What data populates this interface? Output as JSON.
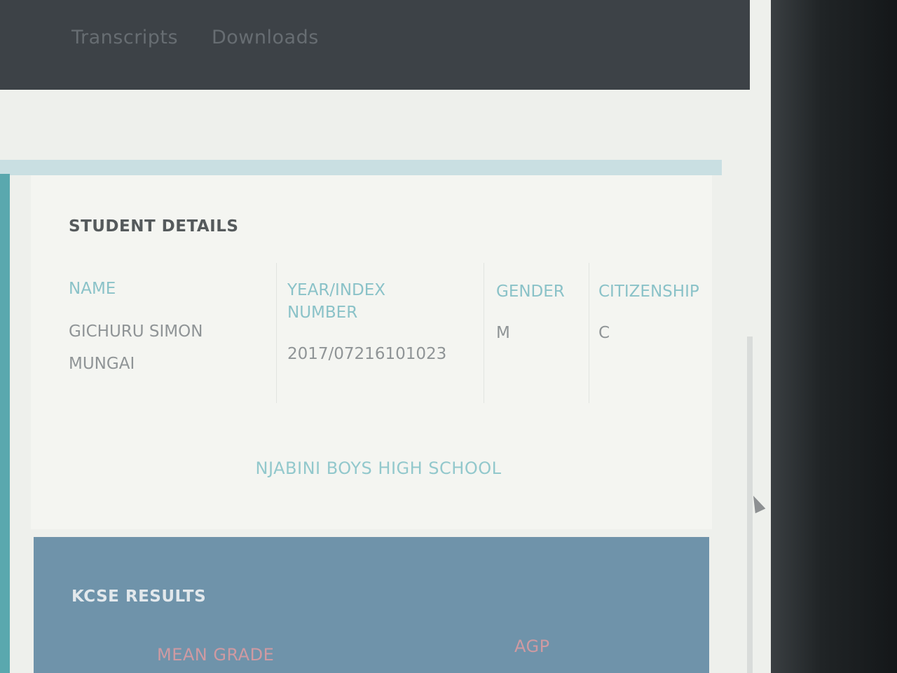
{
  "nav": {
    "items": [
      "Transcripts",
      "Downloads"
    ]
  },
  "student_details": {
    "title": "STUDENT DETAILS",
    "headers": {
      "name": "NAME",
      "index": "YEAR/INDEX NUMBER",
      "gender": "GENDER",
      "citizenship": "CITIZENSHIP"
    },
    "values": {
      "name": "GICHURU SIMON MUNGAI",
      "index": "2017/07216101023",
      "gender": "M",
      "citizenship": "C"
    },
    "school": "NJABINI BOYS HIGH SCHOOL"
  },
  "kcse_results": {
    "title": "KCSE RESULTS",
    "headers": {
      "mean_grade": "MEAN GRADE",
      "agp": "AGP"
    }
  },
  "colors": {
    "nav_bg": "#3d4247",
    "accent_teal": "#8ac2c8",
    "results_bg": "#6f93aa"
  }
}
